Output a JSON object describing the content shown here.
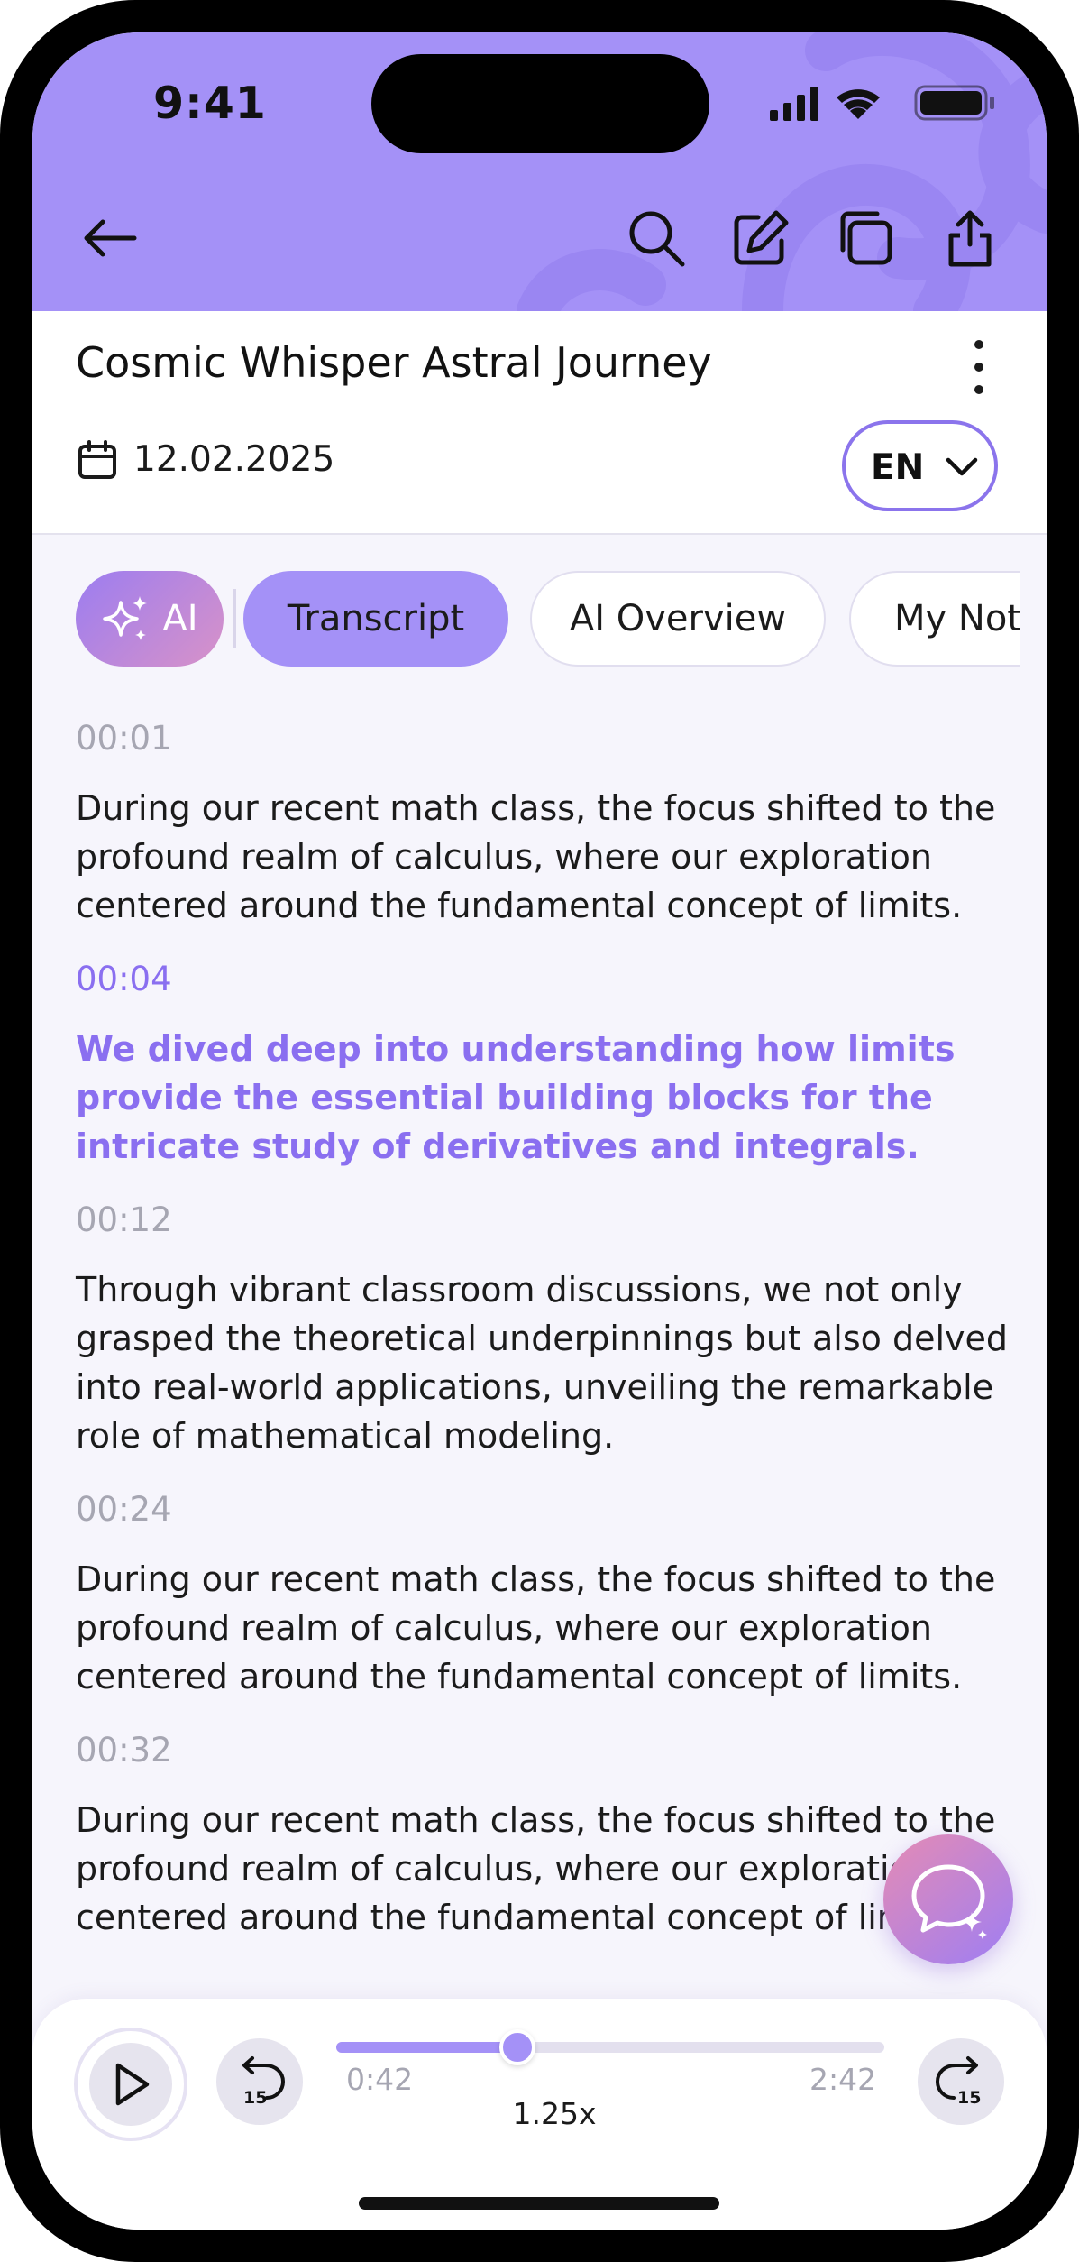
{
  "status_bar": {
    "time": "9:41"
  },
  "header": {
    "icons": [
      "back-arrow-icon",
      "search-icon",
      "edit-icon",
      "copy-icon",
      "share-icon"
    ],
    "bg_color": "#a491f7"
  },
  "recording": {
    "title": "Cosmic Whisper Astral Journey",
    "date": "12.02.2025",
    "language": "EN"
  },
  "tabs": {
    "ai_label": "AI",
    "items": [
      "Transcript",
      "AI Overview",
      "My Notes"
    ],
    "selected": "Transcript"
  },
  "transcript": [
    {
      "time": "00:01",
      "text": "During our recent math class, the focus shifted to the profound realm of calculus, where our exploration centered around the fundamental concept of limits."
    },
    {
      "time": "00:04",
      "text": "We dived deep into understanding how limits provide the essential building blocks for the intricate study of derivatives and integrals.",
      "active": true
    },
    {
      "time": "00:12",
      "text": "Through vibrant classroom discussions, we not only grasped the theoretical underpinnings but also delved into real-world applications, unveiling the remarkable role of mathematical modeling."
    },
    {
      "time": "00:24",
      "text": "During our recent math class, the focus shifted to the profound realm of calculus, where our exploration centered around the fundamental concept of limits."
    },
    {
      "time": "00:32",
      "text": "During our recent math class, the focus shifted to the profound realm of calculus, where our exploration centered around the fundamental concept of limits."
    }
  ],
  "player": {
    "current_time": "0:42",
    "total_time": "2:42",
    "progress": 0.33,
    "speed": "1.25x",
    "skip_back": "15",
    "skip_forward": "15"
  },
  "colors": {
    "accent": "#a491f7",
    "accent_text": "#8a6ff0"
  }
}
